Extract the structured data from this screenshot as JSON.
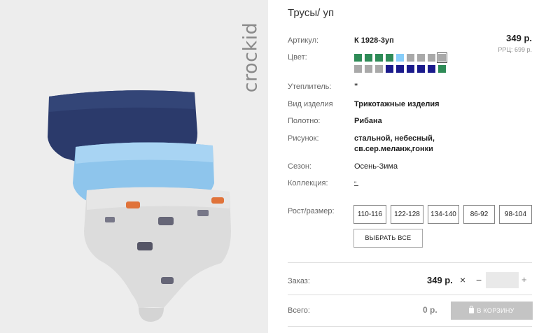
{
  "product": {
    "title": "Трусы/ уп",
    "brand": "crockid",
    "price": "349 р.",
    "rrp": "РРЦ: 699 р."
  },
  "specs": {
    "article_label": "Артикул:",
    "article_value": "К 1928-3уп",
    "color_label": "Цвет:",
    "insulation_label": "Утеплитель:",
    "insulation_value": "\"",
    "type_label": "Вид изделия",
    "type_value": "Трикотажные изделия",
    "fabric_label": "Полотно:",
    "fabric_value": "Рибана",
    "pattern_label": "Рисунок:",
    "pattern_value_1": "стальной, небесный,",
    "pattern_value_2": "св.сер.меланж,гонки",
    "season_label": "Сезон:",
    "season_value": "Осень-Зима",
    "collection_label": "Коллекция:",
    "collection_value": "\"",
    "size_label": "Рост/размер:"
  },
  "swatches": {
    "row1": [
      "#2e8b57",
      "#2e8b57",
      "#2e8b57",
      "#2e8b57",
      "#87cefa",
      "#a9a9a9",
      "#a9a9a9",
      "#a9a9a9",
      "#a9a9a9"
    ],
    "row2": [
      "#a9a9a9",
      "#a9a9a9",
      "#a9a9a9",
      "#1a1a8c",
      "#1a1a8c",
      "#1a1a8c",
      "#1a1a8c",
      "#1a1a8c",
      "#2e8b57"
    ]
  },
  "sizes": [
    "110-116",
    "122-128",
    "134-140",
    "86-92",
    "98-104"
  ],
  "select_all": "ВЫБРАТЬ ВСЕ",
  "order": {
    "order_label": "Заказ:",
    "order_price": "349 р.",
    "times": "×",
    "minus": "−",
    "plus": "+",
    "total_label": "Всего:",
    "total_value": "0 р.",
    "cart_button": "В КОРЗИНУ"
  }
}
